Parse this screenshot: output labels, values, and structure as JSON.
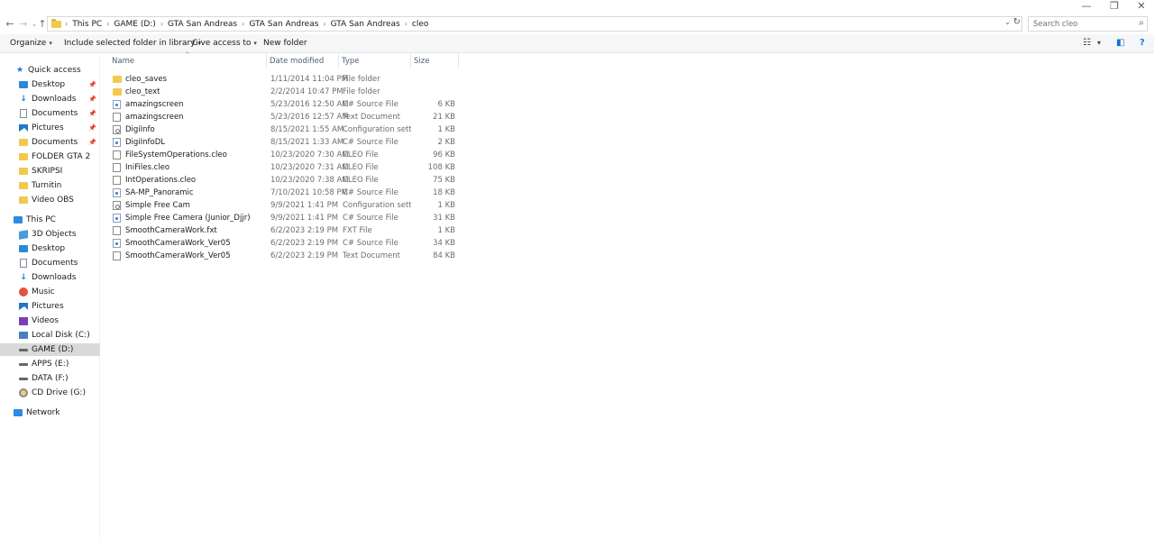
{
  "window": {
    "minimize_glyph": "—",
    "restore_glyph": "❐",
    "close_glyph": "✕"
  },
  "address_bar": {
    "crumbs": [
      "This PC",
      "GAME (D:)",
      "GTA San Andreas",
      "GTA San Andreas",
      "GTA San Andreas",
      "cleo"
    ],
    "separator": "›",
    "back_glyph": "←",
    "forward_glyph": "→",
    "dropdown_glyph": "⌄",
    "recent_glyph": "⌄",
    "up_glyph": "↑",
    "refresh_glyph": "↻"
  },
  "search": {
    "placeholder": "Search cleo",
    "icon": "search-icon"
  },
  "command_bar": {
    "organize": "Organize",
    "include_in_library": "Include selected folder in library",
    "give_access": "Give access to",
    "new_folder": "New folder",
    "caret": "▾",
    "view_glyph": "☷",
    "view_caret": "▾",
    "preview_glyph": "◧",
    "help_glyph": "?"
  },
  "sidebar": {
    "pin_glyph": "📌",
    "items": [
      {
        "label": "Quick access",
        "icon": "star-icon",
        "pinned": false
      },
      {
        "label": "Desktop",
        "icon": "desktop-icon",
        "pinned": true
      },
      {
        "label": "Downloads",
        "icon": "download-icon",
        "pinned": true
      },
      {
        "label": "Documents",
        "icon": "documents-icon",
        "pinned": true
      },
      {
        "label": "Pictures",
        "icon": "pictures-icon",
        "pinned": true
      },
      {
        "label": "Documents",
        "icon": "folder-icon",
        "pinned": true
      },
      {
        "label": "FOLDER GTA 2",
        "icon": "folder-icon",
        "pinned": false
      },
      {
        "label": "SKRIPSI",
        "icon": "folder-icon",
        "pinned": false
      },
      {
        "label": "Turnitin",
        "icon": "folder-icon",
        "pinned": false
      },
      {
        "label": "Video OBS",
        "icon": "folder-icon",
        "pinned": false
      },
      {
        "label": "This PC",
        "icon": "computer-icon",
        "pinned": false
      },
      {
        "label": "3D Objects",
        "icon": "3d-objects-icon",
        "pinned": false
      },
      {
        "label": "Desktop",
        "icon": "desktop-icon",
        "pinned": false
      },
      {
        "label": "Documents",
        "icon": "documents-icon",
        "pinned": false
      },
      {
        "label": "Downloads",
        "icon": "download-icon",
        "pinned": false
      },
      {
        "label": "Music",
        "icon": "music-icon",
        "pinned": false
      },
      {
        "label": "Pictures",
        "icon": "pictures-icon",
        "pinned": false
      },
      {
        "label": "Videos",
        "icon": "videos-icon",
        "pinned": false
      },
      {
        "label": "Local Disk (C:)",
        "icon": "windows-disk-icon",
        "pinned": false
      },
      {
        "label": "GAME (D:)",
        "icon": "drive-icon",
        "pinned": false,
        "selected": true
      },
      {
        "label": "APPS (E:)",
        "icon": "drive-icon",
        "pinned": false
      },
      {
        "label": "DATA (F:)",
        "icon": "drive-icon",
        "pinned": false
      },
      {
        "label": "CD Drive (G:)",
        "icon": "cd-drive-icon",
        "pinned": false
      },
      {
        "label": "Network",
        "icon": "network-icon",
        "pinned": false
      }
    ]
  },
  "file_list": {
    "columns": {
      "name": "Name",
      "date": "Date modified",
      "type": "Type",
      "size": "Size"
    },
    "sort_glyph": "^",
    "rows": [
      {
        "icon": "folder-icon",
        "name": "cleo_saves",
        "date": "1/11/2014 11:04 PM",
        "type": "File folder",
        "size": ""
      },
      {
        "icon": "folder-icon",
        "name": "cleo_text",
        "date": "2/2/2014 10:47 PM",
        "type": "File folder",
        "size": ""
      },
      {
        "icon": "csharp-file-icon",
        "name": "amazingscreen",
        "date": "5/23/2016 12:50 AM",
        "type": "C# Source File",
        "size": "6 KB"
      },
      {
        "icon": "text-file-icon",
        "name": "amazingscreen",
        "date": "5/23/2016 12:57 AM",
        "type": "Text Document",
        "size": "21 KB"
      },
      {
        "icon": "config-file-icon",
        "name": "DigiInfo",
        "date": "8/15/2021 1:55 AM",
        "type": "Configuration sett...",
        "size": "1 KB"
      },
      {
        "icon": "csharp-file-icon",
        "name": "DigiInfoDL",
        "date": "8/15/2021 1:33 AM",
        "type": "C# Source File",
        "size": "2 KB"
      },
      {
        "icon": "cleo-file-icon",
        "name": "FileSystemOperations.cleo",
        "date": "10/23/2020 7:30 AM",
        "type": "CLEO File",
        "size": "96 KB"
      },
      {
        "icon": "cleo-file-icon",
        "name": "IniFiles.cleo",
        "date": "10/23/2020 7:31 AM",
        "type": "CLEO File",
        "size": "108 KB"
      },
      {
        "icon": "cleo-file-icon",
        "name": "IntOperations.cleo",
        "date": "10/23/2020 7:38 AM",
        "type": "CLEO File",
        "size": "75 KB"
      },
      {
        "icon": "csharp-file-icon",
        "name": "SA-MP_Panoramic",
        "date": "7/10/2021 10:58 PM",
        "type": "C# Source File",
        "size": "18 KB"
      },
      {
        "icon": "config-file-icon",
        "name": "Simple Free Cam",
        "date": "9/9/2021 1:41 PM",
        "type": "Configuration sett...",
        "size": "1 KB"
      },
      {
        "icon": "csharp-file-icon",
        "name": "Simple Free Camera (Junior_Djjr)",
        "date": "9/9/2021 1:41 PM",
        "type": "C# Source File",
        "size": "31 KB"
      },
      {
        "icon": "cleo-file-icon",
        "name": "SmoothCameraWork.fxt",
        "date": "6/2/2023 2:19 PM",
        "type": "FXT File",
        "size": "1 KB"
      },
      {
        "icon": "csharp-file-icon",
        "name": "SmoothCameraWork_Ver05",
        "date": "6/2/2023 2:19 PM",
        "type": "C# Source File",
        "size": "34 KB"
      },
      {
        "icon": "text-file-icon",
        "name": "SmoothCameraWork_Ver05",
        "date": "6/2/2023 2:19 PM",
        "type": "Text Document",
        "size": "84 KB"
      }
    ]
  }
}
